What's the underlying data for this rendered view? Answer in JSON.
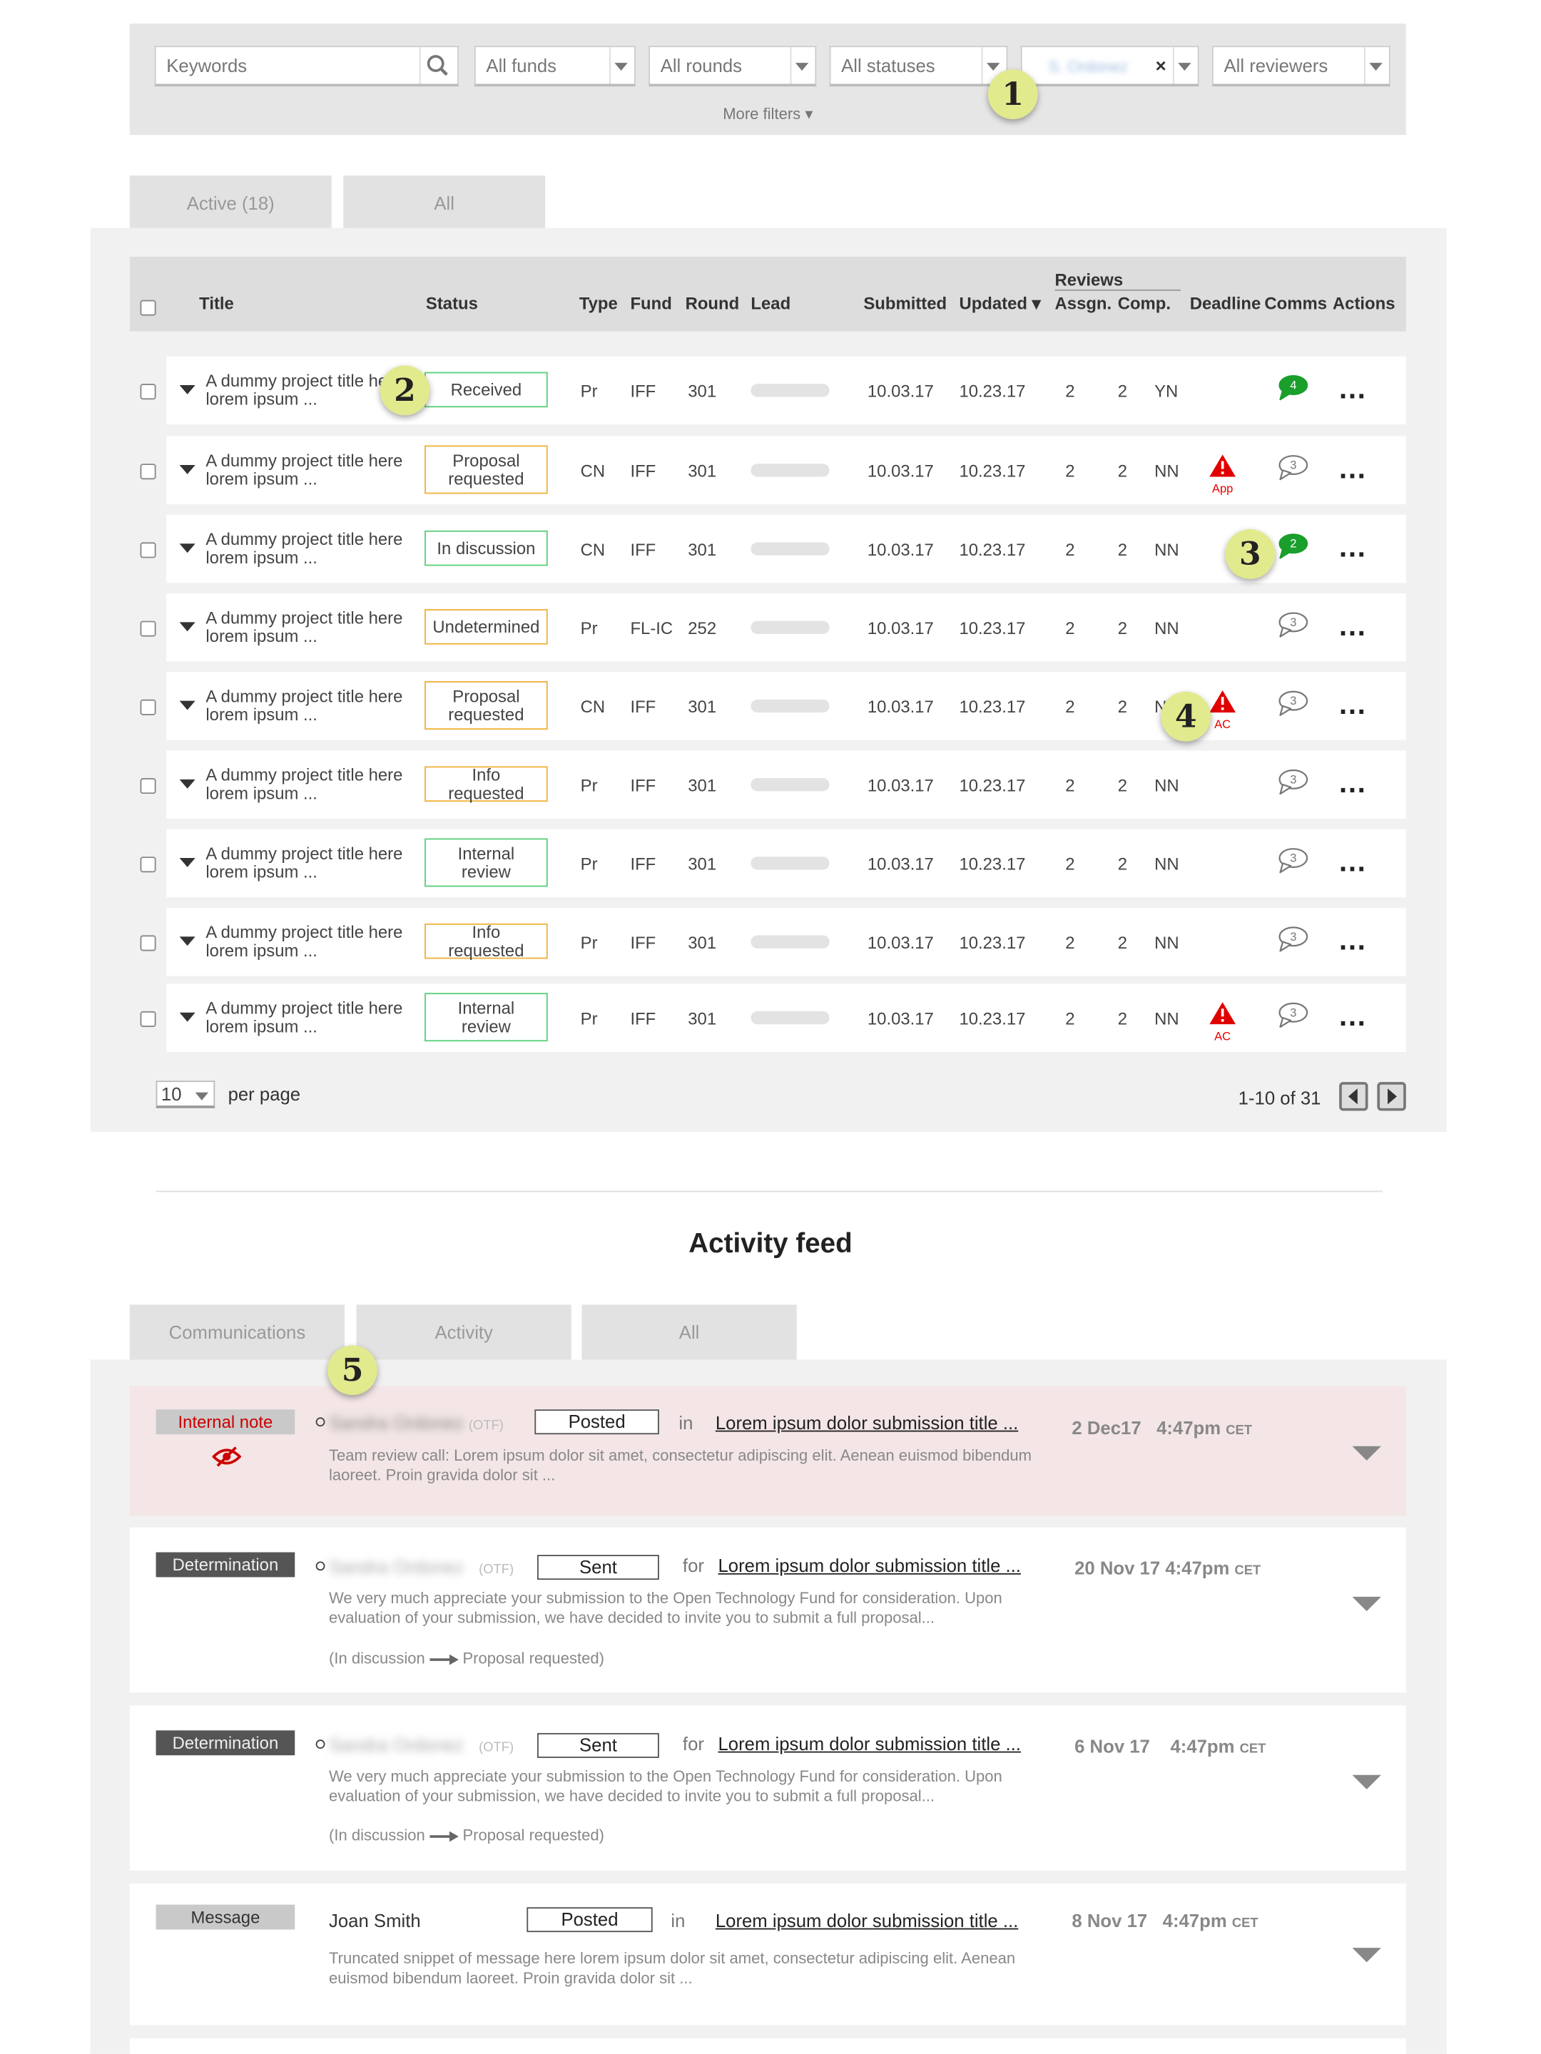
{
  "filters": {
    "keywords_placeholder": "Keywords",
    "funds": "All funds",
    "rounds": "All rounds",
    "statuses": "All statuses",
    "lead_value": "S. Ordonez",
    "lead_clear": "×",
    "reviewers": "All reviewers",
    "more": "More filters ▾"
  },
  "badges": [
    "1",
    "2",
    "3",
    "4",
    "5"
  ],
  "tabs": {
    "active": "Active (18)",
    "all": "All"
  },
  "table": {
    "headers": {
      "title": "Title",
      "status": "Status",
      "type": "Type",
      "fund": "Fund",
      "round": "Round",
      "lead": "Lead",
      "submitted": "Submitted",
      "updated": "Updated ▾",
      "reviews": "Reviews",
      "assigned": "Assgn.",
      "completed": "Comp.",
      "deadline": "Deadline",
      "comms": "Comms",
      "actions": "Actions"
    },
    "rows": [
      {
        "title1": "A dummy project title here",
        "title2": "lorem ipsum ...",
        "status": "Received",
        "status_color": "#5ad07a",
        "type": "Pr",
        "fund": "IFF",
        "round": "301",
        "submitted": "10.03.17",
        "updated": "10.23.17",
        "assigned": "2",
        "completed": "2",
        "yn": "YN",
        "deadline": "",
        "comms": "4",
        "comms_unread": true
      },
      {
        "title1": "A dummy project title here",
        "title2": "lorem ipsum ...",
        "status": "Proposal requested",
        "status_color": "#f0b23a",
        "type": "CN",
        "fund": "IFF",
        "round": "301",
        "submitted": "10.03.17",
        "updated": "10.23.17",
        "assigned": "2",
        "completed": "2",
        "yn": "NN",
        "deadline": "App",
        "comms": "3",
        "comms_unread": false
      },
      {
        "title1": "A dummy project title here",
        "title2": "lorem ipsum ...",
        "status": "In discussion",
        "status_color": "#5ad07a",
        "type": "CN",
        "fund": "IFF",
        "round": "301",
        "submitted": "10.03.17",
        "updated": "10.23.17",
        "assigned": "2",
        "completed": "2",
        "yn": "NN",
        "deadline": "",
        "comms": "2",
        "comms_unread": true
      },
      {
        "title1": "A dummy project title here",
        "title2": "lorem ipsum ...",
        "status": "Undetermined",
        "status_color": "#f0b23a",
        "type": "Pr",
        "fund": "FL-IC",
        "round": "252",
        "submitted": "10.03.17",
        "updated": "10.23.17",
        "assigned": "2",
        "completed": "2",
        "yn": "NN",
        "deadline": "",
        "comms": "3",
        "comms_unread": false
      },
      {
        "title1": "A dummy project title here",
        "title2": "lorem ipsum ...",
        "status": "Proposal requested",
        "status_color": "#f0b23a",
        "type": "CN",
        "fund": "IFF",
        "round": "301",
        "submitted": "10.03.17",
        "updated": "10.23.17",
        "assigned": "2",
        "completed": "2",
        "yn": "NN",
        "deadline": "AC",
        "comms": "3",
        "comms_unread": false
      },
      {
        "title1": "A dummy project title here",
        "title2": "lorem ipsum ...",
        "status": "Info requested",
        "status_color": "#f0b23a",
        "type": "Pr",
        "fund": "IFF",
        "round": "301",
        "submitted": "10.03.17",
        "updated": "10.23.17",
        "assigned": "2",
        "completed": "2",
        "yn": "NN",
        "deadline": "",
        "comms": "3",
        "comms_unread": false
      },
      {
        "title1": "A dummy project title here",
        "title2": "lorem ipsum ...",
        "status": "Internal review",
        "status_color": "#5ad07a",
        "type": "Pr",
        "fund": "IFF",
        "round": "301",
        "submitted": "10.03.17",
        "updated": "10.23.17",
        "assigned": "2",
        "completed": "2",
        "yn": "NN",
        "deadline": "",
        "comms": "3",
        "comms_unread": false
      },
      {
        "title1": "A dummy project title here",
        "title2": "lorem ipsum ...",
        "status": "Info requested",
        "status_color": "#f0b23a",
        "type": "Pr",
        "fund": "IFF",
        "round": "301",
        "submitted": "10.03.17",
        "updated": "10.23.17",
        "assigned": "2",
        "completed": "2",
        "yn": "NN",
        "deadline": "",
        "comms": "3",
        "comms_unread": false
      },
      {
        "title1": "A dummy project title here",
        "title2": "lorem ipsum ...",
        "status": "Internal review",
        "status_color": "#5ad07a",
        "type": "Pr",
        "fund": "IFF",
        "round": "301",
        "submitted": "10.03.17",
        "updated": "10.23.17",
        "assigned": "2",
        "completed": "2",
        "yn": "NN",
        "deadline": "AC",
        "comms": "3",
        "comms_unread": false
      }
    ],
    "per_page_value": "10",
    "per_page_label": "per page",
    "range": "1-10 of 31"
  },
  "activity": {
    "title": "Activity feed",
    "tabs": [
      "Communications",
      "Activity",
      "All"
    ],
    "items": [
      {
        "tag": "Internal note",
        "who": "Sandra Ordonez",
        "org": "(OTF)",
        "action": "Posted",
        "prep": "in",
        "link": "Lorem ipsum dolor submission title ...",
        "date": "2 Dec17",
        "time": "4:47pm",
        "tz": "CET",
        "snippet": "Team review call:  Lorem ipsum dolor sit amet, consectetur adipiscing elit. Aenean euismod bibendum laoreet. Proin gravida dolor sit ..."
      },
      {
        "tag": "Determination",
        "who": "Sandra Ordonez",
        "org": "(OTF)",
        "action": "Sent",
        "prep": "for",
        "link": "Lorem ipsum dolor submission title ...",
        "date": "20 Nov 17",
        "time": "4:47pm",
        "tz": "CET",
        "snippet": "We very much appreciate your submission to the Open Technology Fund for consideration. Upon evaluation of your submission, we have decided to invite you to submit a full proposal...",
        "from": "(In discussion",
        "to": "Proposal requested)"
      },
      {
        "tag": "Determination",
        "who": "Sandra Ordonez",
        "org": "(OTF)",
        "action": "Sent",
        "prep": "for",
        "link": "Lorem ipsum dolor submission title ...",
        "date": "6 Nov 17",
        "time": "4:47pm",
        "tz": "CET",
        "snippet": "We very much appreciate your submission to the Open Technology Fund for consideration. Upon evaluation of your submission, we have decided to invite you to submit a full proposal...",
        "from": "(In discussion",
        "to": "Proposal requested)"
      },
      {
        "tag": "Message",
        "who": "Joan Smith",
        "action": "Posted",
        "prep": "in",
        "link": "Lorem ipsum dolor submission title ...",
        "date": "8 Nov 17",
        "time": "4:47pm",
        "tz": "CET",
        "snippet": "Truncated snippet of message here lorem ipsum dolor sit amet, consectetur adipiscing elit. Aenean euismod bibendum laoreet. Proin gravida dolor sit ..."
      }
    ]
  },
  "colors": {
    "note_bg": "#f4e6e6",
    "green": "#1a9e2c",
    "alert": "#e00000",
    "badge": "#e2ea8e"
  }
}
